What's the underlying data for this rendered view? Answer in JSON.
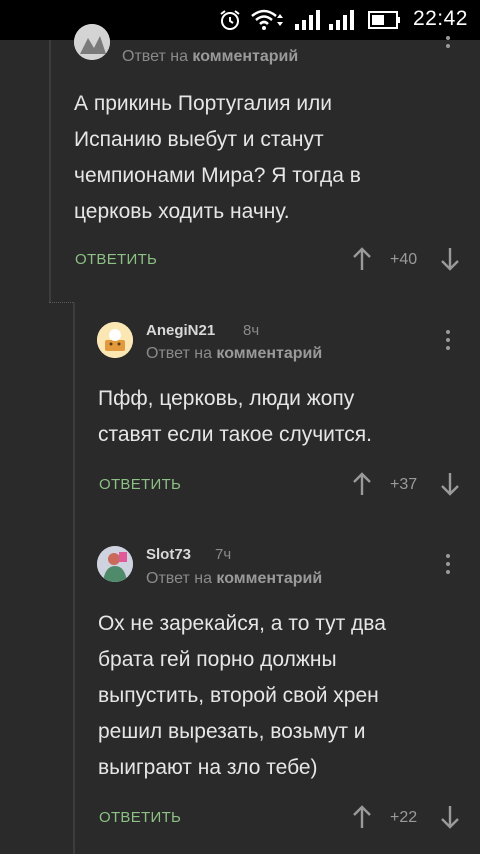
{
  "statusbar": {
    "time": "22:42",
    "icons": [
      "alarm-icon",
      "wifi-icon",
      "signal-icon",
      "signal-icon",
      "battery-icon"
    ]
  },
  "labels": {
    "reply_prefix": "Ответ на",
    "reply_target": "комментарий",
    "reply_button": "ОТВЕТИТЬ"
  },
  "comments": [
    {
      "username": "",
      "time": "",
      "body": "А прикинь Португалия или Испанию выебут и станут чемпионами Мира? Я тогда в церковь ходить начну.",
      "score": "+40"
    },
    {
      "username": "AnegiN21",
      "time": "8ч",
      "body": "Пфф, церковь, люди жопу ставят если такое случится.",
      "score": "+37"
    },
    {
      "username": "Slot73",
      "time": "7ч",
      "body": "Ох не зарекайся, а то тут два брата гей порно должны выпустить, второй свой хрен решил вырезать, возьмут и выиграют на зло тебе)",
      "score": "+22"
    }
  ],
  "colors": {
    "background": "#2a2a2a",
    "accent_green": "#8cc084",
    "muted": "#8a8a8a"
  }
}
